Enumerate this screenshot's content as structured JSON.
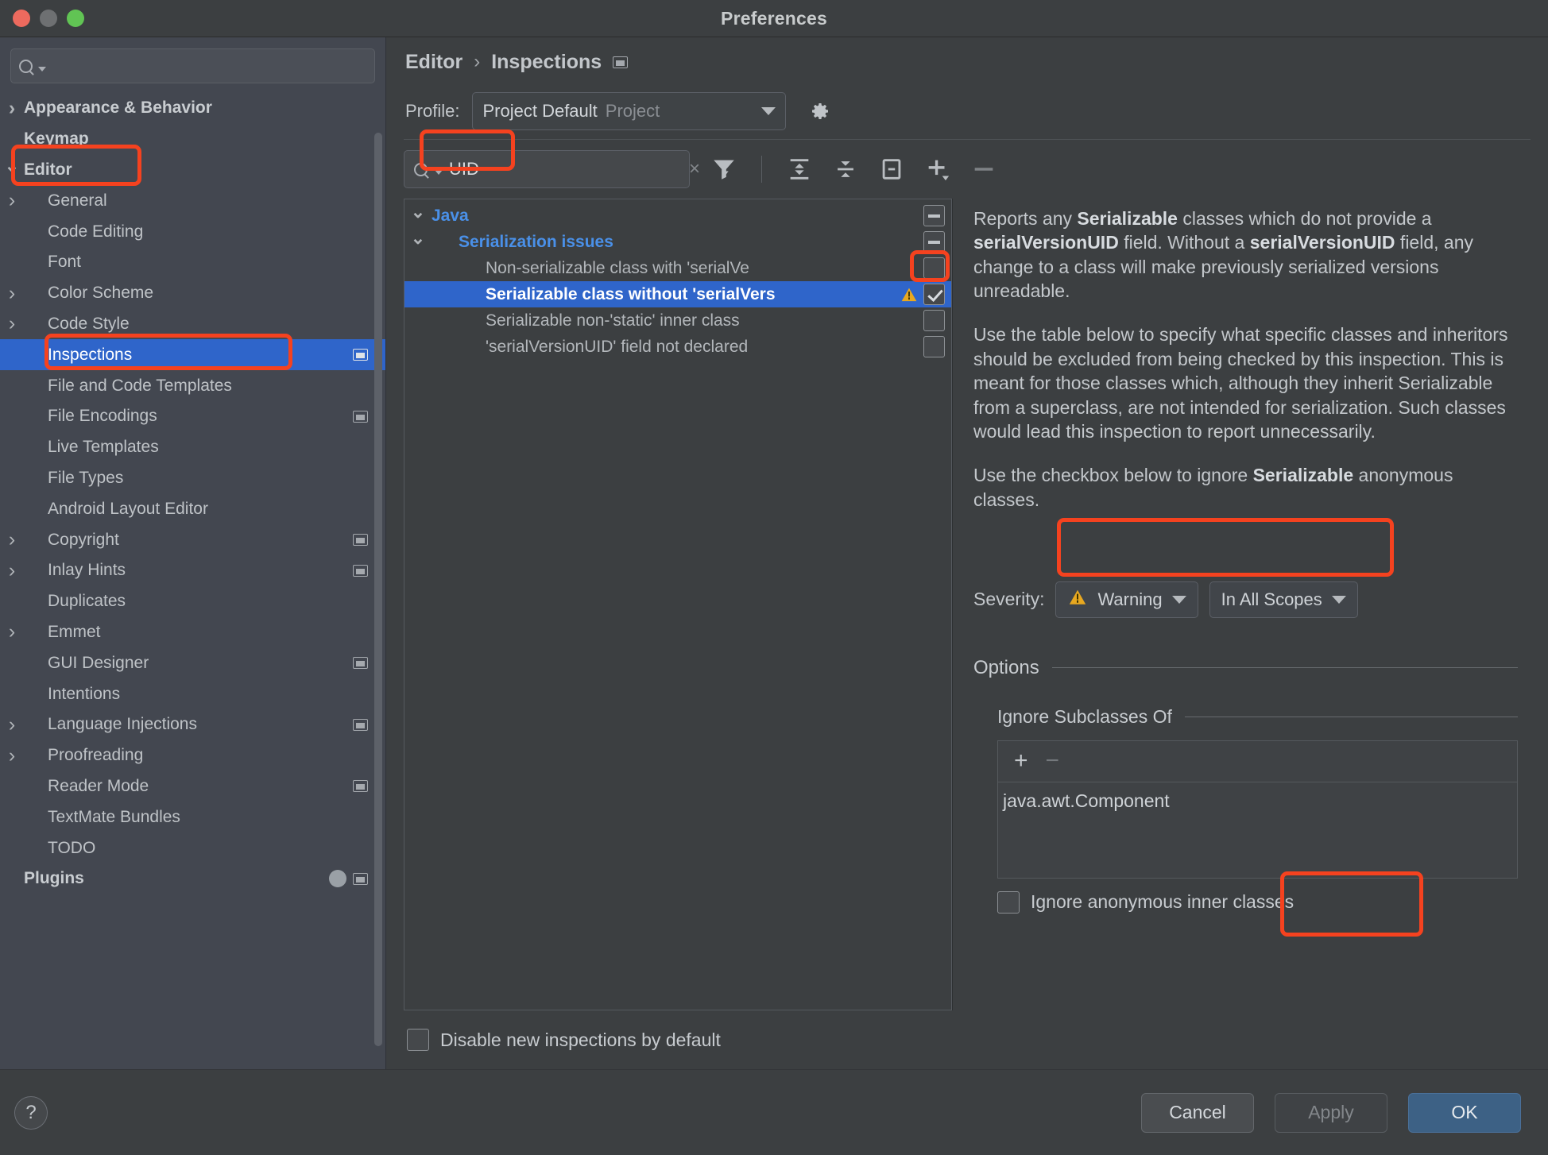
{
  "window": {
    "title": "Preferences",
    "traffic_lights": [
      "close-red",
      "minimize-gray",
      "zoom-green"
    ]
  },
  "sidebar": {
    "search": {
      "value": "",
      "placeholder": ""
    },
    "items": [
      {
        "label": "Appearance & Behavior",
        "arrow": "right",
        "indent": 0,
        "bold": true,
        "badge": "",
        "selected": false
      },
      {
        "label": "Keymap",
        "arrow": "none",
        "indent": 0,
        "bold": true,
        "badge": "",
        "selected": false
      },
      {
        "label": "Editor",
        "arrow": "down",
        "indent": 0,
        "bold": true,
        "badge": "",
        "selected": false
      },
      {
        "label": "General",
        "arrow": "right",
        "indent": 1,
        "bold": false,
        "badge": "",
        "selected": false
      },
      {
        "label": "Code Editing",
        "arrow": "none",
        "indent": 1,
        "bold": false,
        "badge": "",
        "selected": false
      },
      {
        "label": "Font",
        "arrow": "none",
        "indent": 1,
        "bold": false,
        "badge": "",
        "selected": false
      },
      {
        "label": "Color Scheme",
        "arrow": "right",
        "indent": 1,
        "bold": false,
        "badge": "",
        "selected": false
      },
      {
        "label": "Code Style",
        "arrow": "right",
        "indent": 1,
        "bold": false,
        "badge": "",
        "selected": false
      },
      {
        "label": "Inspections",
        "arrow": "none",
        "indent": 1,
        "bold": false,
        "badge": "window",
        "selected": true
      },
      {
        "label": "File and Code Templates",
        "arrow": "none",
        "indent": 1,
        "bold": false,
        "badge": "",
        "selected": false
      },
      {
        "label": "File Encodings",
        "arrow": "none",
        "indent": 1,
        "bold": false,
        "badge": "window",
        "selected": false
      },
      {
        "label": "Live Templates",
        "arrow": "none",
        "indent": 1,
        "bold": false,
        "badge": "",
        "selected": false
      },
      {
        "label": "File Types",
        "arrow": "none",
        "indent": 1,
        "bold": false,
        "badge": "",
        "selected": false
      },
      {
        "label": "Android Layout Editor",
        "arrow": "none",
        "indent": 1,
        "bold": false,
        "badge": "",
        "selected": false
      },
      {
        "label": "Copyright",
        "arrow": "right",
        "indent": 1,
        "bold": false,
        "badge": "window",
        "selected": false
      },
      {
        "label": "Inlay Hints",
        "arrow": "right",
        "indent": 1,
        "bold": false,
        "badge": "window",
        "selected": false
      },
      {
        "label": "Duplicates",
        "arrow": "none",
        "indent": 1,
        "bold": false,
        "badge": "",
        "selected": false
      },
      {
        "label": "Emmet",
        "arrow": "right",
        "indent": 1,
        "bold": false,
        "badge": "",
        "selected": false
      },
      {
        "label": "GUI Designer",
        "arrow": "none",
        "indent": 1,
        "bold": false,
        "badge": "window",
        "selected": false
      },
      {
        "label": "Intentions",
        "arrow": "none",
        "indent": 1,
        "bold": false,
        "badge": "",
        "selected": false
      },
      {
        "label": "Language Injections",
        "arrow": "right",
        "indent": 1,
        "bold": false,
        "badge": "window",
        "selected": false
      },
      {
        "label": "Proofreading",
        "arrow": "right",
        "indent": 1,
        "bold": false,
        "badge": "",
        "selected": false
      },
      {
        "label": "Reader Mode",
        "arrow": "none",
        "indent": 1,
        "bold": false,
        "badge": "window",
        "selected": false
      },
      {
        "label": "TextMate Bundles",
        "arrow": "none",
        "indent": 1,
        "bold": false,
        "badge": "",
        "selected": false
      },
      {
        "label": "TODO",
        "arrow": "none",
        "indent": 1,
        "bold": false,
        "badge": "",
        "selected": false
      },
      {
        "label": "Plugins",
        "arrow": "none",
        "indent": 0,
        "bold": true,
        "badge": "circle-window",
        "selected": false
      }
    ],
    "help_button": "?"
  },
  "main": {
    "breadcrumb": {
      "root": "Editor",
      "separator": "›",
      "leaf": "Inspections",
      "badge_icon": "window-icon"
    },
    "profile": {
      "label": "Profile:",
      "name": "Project Default",
      "scope": "Project",
      "gear_icon": "gear-icon"
    },
    "filter_toolbar": {
      "search_value": "UID",
      "search_placeholder": "",
      "clear_icon": "×",
      "icons": [
        "filter-icon",
        "expand-all-icon",
        "collapse-all-icon",
        "toggle-icon",
        "add-icon",
        "remove-icon"
      ]
    },
    "inspection_tree": [
      {
        "label": "Java",
        "indent": 0,
        "arrow": "down",
        "kind": "group",
        "check": "dash",
        "warn": false,
        "selected": false
      },
      {
        "label": "Serialization issues",
        "indent": 1,
        "arrow": "down",
        "kind": "group",
        "check": "dash",
        "warn": false,
        "selected": false
      },
      {
        "label": "Non-serializable class with 'serialVe",
        "indent": 2,
        "arrow": "none",
        "kind": "leaf",
        "check": "unchecked",
        "warn": false,
        "selected": false
      },
      {
        "label": "Serializable class without 'serialVers",
        "indent": 2,
        "arrow": "none",
        "kind": "leaf",
        "check": "checked",
        "warn": true,
        "selected": true
      },
      {
        "label": "Serializable non-'static' inner class",
        "indent": 2,
        "arrow": "none",
        "kind": "leaf",
        "check": "unchecked",
        "warn": false,
        "selected": false
      },
      {
        "label": "'serialVersionUID' field not declared",
        "indent": 2,
        "arrow": "none",
        "kind": "leaf",
        "check": "unchecked",
        "warn": false,
        "selected": false
      }
    ],
    "description": {
      "para1_a": "Reports any ",
      "para1_b": "Serializable",
      "para1_c": " classes which do not provide a ",
      "para1_d": "serialVersionUID",
      "para1_e": " field. Without a ",
      "para1_f": "serialVersionUID",
      "para1_g": " field, any change to a class will make previously serialized versions unreadable.",
      "para2": "Use the table below to specify what specific classes and inheritors should be excluded from being checked by this inspection. This is meant for those classes which, although they inherit Serializable from a superclass, are not intended for serialization. Such classes would lead this inspection to report unnecessarily.",
      "para3_a": "Use the checkbox below to ignore ",
      "para3_b": "Serializable",
      "para3_c": " anonymous classes."
    },
    "severity": {
      "label": "Severity:",
      "level": "Warning",
      "level_icon": "warning-triangle-icon",
      "scope": "In All Scopes"
    },
    "options": {
      "title": "Options",
      "subsection_title": "Ignore Subclasses Of",
      "table_add": "+",
      "table_remove": "−",
      "rows": [
        "java.awt.Component"
      ],
      "ignore_anonymous_label": "Ignore anonymous inner classes",
      "ignore_anonymous_checked": false
    },
    "disable_new": {
      "label": "Disable new inspections by default",
      "checked": false
    }
  },
  "footer": {
    "cancel": "Cancel",
    "apply": "Apply",
    "ok": "OK"
  },
  "colors": {
    "accent_selection": "#2f65ca",
    "highlight_box": "#f5421f",
    "group_text": "#4a90e8",
    "warning_yellow": "#e8a820",
    "primary_button": "#3d6185"
  }
}
